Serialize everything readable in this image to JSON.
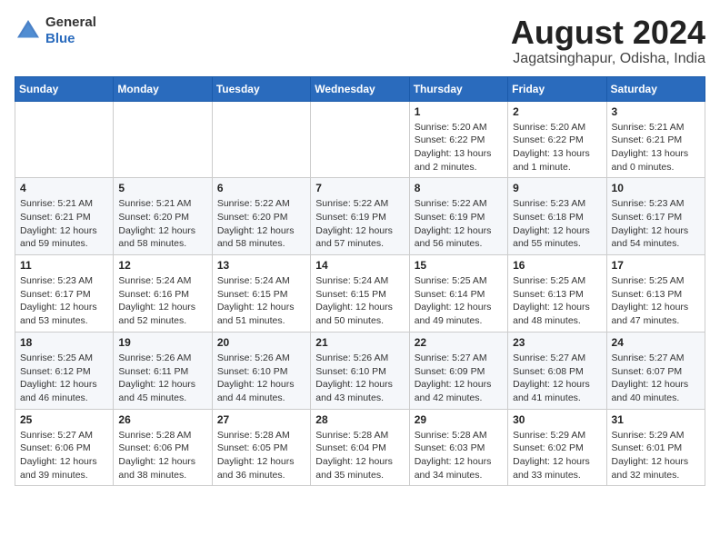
{
  "header": {
    "logo_general": "General",
    "logo_blue": "Blue",
    "month_year": "August 2024",
    "location": "Jagatsinghapur, Odisha, India"
  },
  "days_of_week": [
    "Sunday",
    "Monday",
    "Tuesday",
    "Wednesday",
    "Thursday",
    "Friday",
    "Saturday"
  ],
  "weeks": [
    [
      {
        "day": "",
        "info": ""
      },
      {
        "day": "",
        "info": ""
      },
      {
        "day": "",
        "info": ""
      },
      {
        "day": "",
        "info": ""
      },
      {
        "day": "1",
        "info": "Sunrise: 5:20 AM\nSunset: 6:22 PM\nDaylight: 13 hours\nand 2 minutes."
      },
      {
        "day": "2",
        "info": "Sunrise: 5:20 AM\nSunset: 6:22 PM\nDaylight: 13 hours\nand 1 minute."
      },
      {
        "day": "3",
        "info": "Sunrise: 5:21 AM\nSunset: 6:21 PM\nDaylight: 13 hours\nand 0 minutes."
      }
    ],
    [
      {
        "day": "4",
        "info": "Sunrise: 5:21 AM\nSunset: 6:21 PM\nDaylight: 12 hours\nand 59 minutes."
      },
      {
        "day": "5",
        "info": "Sunrise: 5:21 AM\nSunset: 6:20 PM\nDaylight: 12 hours\nand 58 minutes."
      },
      {
        "day": "6",
        "info": "Sunrise: 5:22 AM\nSunset: 6:20 PM\nDaylight: 12 hours\nand 58 minutes."
      },
      {
        "day": "7",
        "info": "Sunrise: 5:22 AM\nSunset: 6:19 PM\nDaylight: 12 hours\nand 57 minutes."
      },
      {
        "day": "8",
        "info": "Sunrise: 5:22 AM\nSunset: 6:19 PM\nDaylight: 12 hours\nand 56 minutes."
      },
      {
        "day": "9",
        "info": "Sunrise: 5:23 AM\nSunset: 6:18 PM\nDaylight: 12 hours\nand 55 minutes."
      },
      {
        "day": "10",
        "info": "Sunrise: 5:23 AM\nSunset: 6:17 PM\nDaylight: 12 hours\nand 54 minutes."
      }
    ],
    [
      {
        "day": "11",
        "info": "Sunrise: 5:23 AM\nSunset: 6:17 PM\nDaylight: 12 hours\nand 53 minutes."
      },
      {
        "day": "12",
        "info": "Sunrise: 5:24 AM\nSunset: 6:16 PM\nDaylight: 12 hours\nand 52 minutes."
      },
      {
        "day": "13",
        "info": "Sunrise: 5:24 AM\nSunset: 6:15 PM\nDaylight: 12 hours\nand 51 minutes."
      },
      {
        "day": "14",
        "info": "Sunrise: 5:24 AM\nSunset: 6:15 PM\nDaylight: 12 hours\nand 50 minutes."
      },
      {
        "day": "15",
        "info": "Sunrise: 5:25 AM\nSunset: 6:14 PM\nDaylight: 12 hours\nand 49 minutes."
      },
      {
        "day": "16",
        "info": "Sunrise: 5:25 AM\nSunset: 6:13 PM\nDaylight: 12 hours\nand 48 minutes."
      },
      {
        "day": "17",
        "info": "Sunrise: 5:25 AM\nSunset: 6:13 PM\nDaylight: 12 hours\nand 47 minutes."
      }
    ],
    [
      {
        "day": "18",
        "info": "Sunrise: 5:25 AM\nSunset: 6:12 PM\nDaylight: 12 hours\nand 46 minutes."
      },
      {
        "day": "19",
        "info": "Sunrise: 5:26 AM\nSunset: 6:11 PM\nDaylight: 12 hours\nand 45 minutes."
      },
      {
        "day": "20",
        "info": "Sunrise: 5:26 AM\nSunset: 6:10 PM\nDaylight: 12 hours\nand 44 minutes."
      },
      {
        "day": "21",
        "info": "Sunrise: 5:26 AM\nSunset: 6:10 PM\nDaylight: 12 hours\nand 43 minutes."
      },
      {
        "day": "22",
        "info": "Sunrise: 5:27 AM\nSunset: 6:09 PM\nDaylight: 12 hours\nand 42 minutes."
      },
      {
        "day": "23",
        "info": "Sunrise: 5:27 AM\nSunset: 6:08 PM\nDaylight: 12 hours\nand 41 minutes."
      },
      {
        "day": "24",
        "info": "Sunrise: 5:27 AM\nSunset: 6:07 PM\nDaylight: 12 hours\nand 40 minutes."
      }
    ],
    [
      {
        "day": "25",
        "info": "Sunrise: 5:27 AM\nSunset: 6:06 PM\nDaylight: 12 hours\nand 39 minutes."
      },
      {
        "day": "26",
        "info": "Sunrise: 5:28 AM\nSunset: 6:06 PM\nDaylight: 12 hours\nand 38 minutes."
      },
      {
        "day": "27",
        "info": "Sunrise: 5:28 AM\nSunset: 6:05 PM\nDaylight: 12 hours\nand 36 minutes."
      },
      {
        "day": "28",
        "info": "Sunrise: 5:28 AM\nSunset: 6:04 PM\nDaylight: 12 hours\nand 35 minutes."
      },
      {
        "day": "29",
        "info": "Sunrise: 5:28 AM\nSunset: 6:03 PM\nDaylight: 12 hours\nand 34 minutes."
      },
      {
        "day": "30",
        "info": "Sunrise: 5:29 AM\nSunset: 6:02 PM\nDaylight: 12 hours\nand 33 minutes."
      },
      {
        "day": "31",
        "info": "Sunrise: 5:29 AM\nSunset: 6:01 PM\nDaylight: 12 hours\nand 32 minutes."
      }
    ]
  ]
}
